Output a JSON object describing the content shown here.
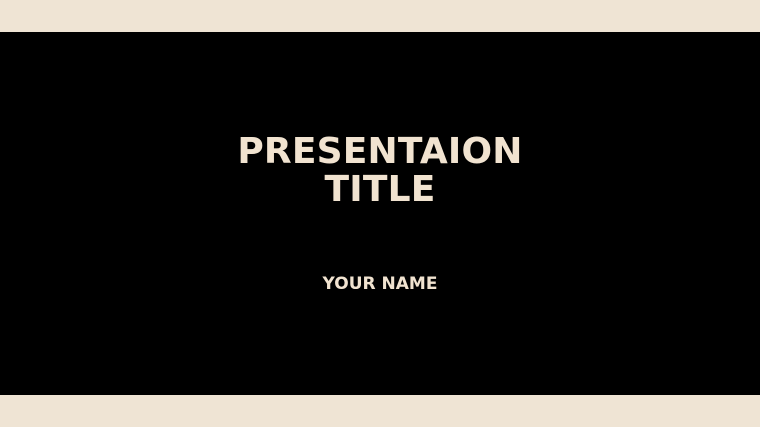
{
  "slide": {
    "title_line_1": "PRESENTAION",
    "title_line_2": "TITLE",
    "subtitle": "YOUR NAME"
  },
  "colors": {
    "background": "#efe4d4",
    "panel": "#000000",
    "text": "#f1e3d0"
  }
}
